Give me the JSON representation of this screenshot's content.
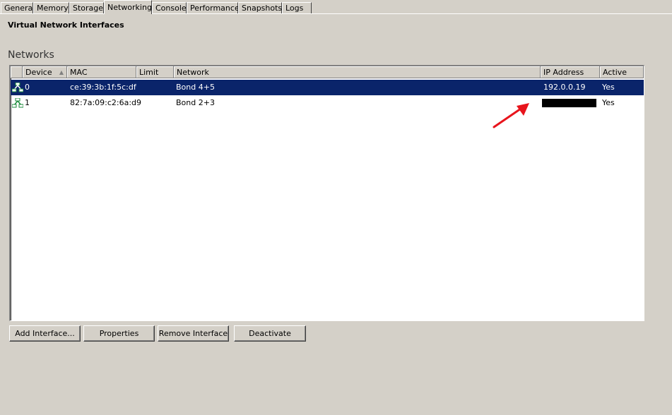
{
  "tabs": [
    "General",
    "Memory",
    "Storage",
    "Networking",
    "Console",
    "Performance",
    "Snapshots",
    "Logs"
  ],
  "active_tab": "Networking",
  "section_title": "Virtual Network Interfaces",
  "group_label": "Networks",
  "columns": {
    "device": "Device",
    "mac": "MAC",
    "limit": "Limit",
    "network": "Network",
    "ip": "IP Address",
    "active": "Active"
  },
  "rows": [
    {
      "device": "0",
      "mac": "ce:39:3b:1f:5c:df",
      "limit": "",
      "network": "Bond 4+5",
      "ip": "192.0.0.19",
      "active": "Yes",
      "selected": true
    },
    {
      "device": "1",
      "mac": "82:7a:09:c2:6a:d9",
      "limit": "",
      "network": "Bond 2+3",
      "ip": "",
      "active": "Yes",
      "selected": false
    }
  ],
  "buttons": {
    "add": "Add Interface...",
    "properties": "Properties",
    "remove": "Remove Interface",
    "deactivate": "Deactivate"
  },
  "colors": {
    "selection": "#0a246a",
    "annotation_arrow": "#e8141c",
    "window_bg": "#d4d0c8"
  },
  "icons": {
    "row": "network-interface-icon",
    "sort": "sort-ascending-icon"
  }
}
